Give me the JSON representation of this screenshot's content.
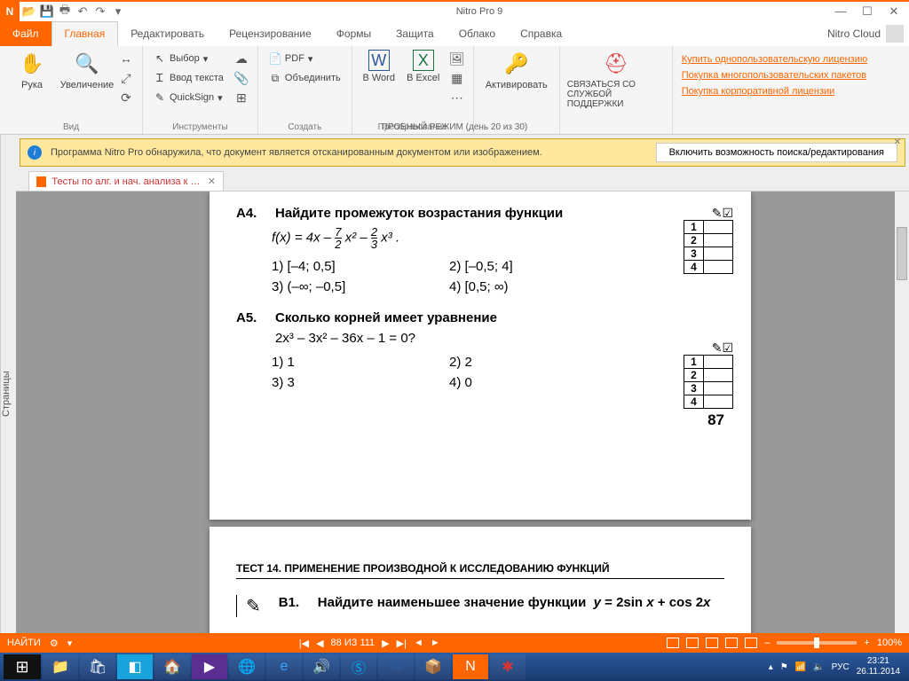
{
  "app": {
    "title": "Nitro Pro 9",
    "cloud": "Nitro Cloud"
  },
  "menu": {
    "file": "Файл",
    "tabs": [
      "Главная",
      "Редактировать",
      "Рецензирование",
      "Формы",
      "Защита",
      "Облако",
      "Справка"
    ],
    "active": 0
  },
  "ribbon": {
    "view": {
      "hand": "Рука",
      "zoom": "Увеличение",
      "group": "Вид"
    },
    "tools": {
      "select": "Выбор",
      "text": "Ввод текста",
      "sign": "QuickSign",
      "group": "Инструменты"
    },
    "create": {
      "pdf": "PDF",
      "combine": "Объединить",
      "group": "Создать"
    },
    "convert": {
      "word": "В Word",
      "excel": "В Excel",
      "group": "Преобразование"
    },
    "activate": "Активировать",
    "support": {
      "label": "СВЯЗАТЬСЯ СО СЛУЖБОЙ ПОДДЕРЖКИ"
    },
    "links": [
      "Купить однопользовательскую лицензию",
      "Покупка многопользовательских пакетов",
      "Покупка корпоративной лицензии"
    ],
    "trial": "ПРОБНЫЙ РЕЖИМ (день 20 из 30)"
  },
  "side": "Страницы",
  "info": {
    "msg": "Программа Nitro Pro обнаружила, что документ является отсканированным документом или изображением.",
    "btn": "Включить возможность поиска/редактирования"
  },
  "doctab": "Тесты по алг. и нач. анализа к Ко...",
  "doc": {
    "a4": {
      "num": "A4.",
      "q": "Найдите промежуток возрастания функции",
      "opts": [
        "1)  [–4; 0,5]",
        "2)  [–0,5; 4]",
        "3)  (–∞; –0,5]",
        "4)  [0,5; ∞)"
      ]
    },
    "a5": {
      "num": "A5.",
      "q": "Сколько корней имеет уравнение",
      "eq": "2x³ – 3x² – 36x – 1 = 0?",
      "opts": [
        "1)  1",
        "2)  2",
        "3)  3",
        "4)  0"
      ]
    },
    "pagenum": "87",
    "test14": "ТЕСТ 14. ПРИМЕНЕНИЕ ПРОИЗВОДНОЙ К ИССЛЕДОВАНИЮ ФУНКЦИЙ",
    "b1": {
      "num": "B1.",
      "q": "Найдите наименьшее значение функции  y = 2sin x + cos 2x"
    }
  },
  "status": {
    "find": "НАЙТИ",
    "page": "88 ИЗ 111",
    "zoom": "100%"
  },
  "tray": {
    "lang": "РУС",
    "time": "23:21",
    "date": "26.11.2014"
  }
}
